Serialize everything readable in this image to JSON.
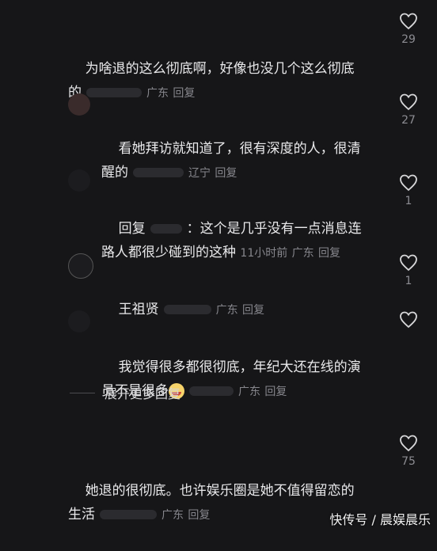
{
  "comments": [
    {
      "text": "为啥退的这么彻底啊，好像也没几个这么彻底",
      "text2": "的",
      "location": "广东",
      "reply": "回复",
      "likes": "29"
    },
    {
      "text": "看她拜访就知道了，很有深度的人，很清",
      "text2": "醒的",
      "location": "辽宁",
      "reply": "回复",
      "likes": "27"
    },
    {
      "text": "回复",
      "text_mid": "：这个是几乎没有一点消息连",
      "text2": "路人都很少碰到的这种",
      "time": "11小时前",
      "location": "广东",
      "reply": "回复",
      "likes": "1"
    },
    {
      "text": "王祖贤",
      "location": "广东",
      "reply": "回复",
      "likes": "1"
    },
    {
      "text": "我觉得很多都很彻底，年纪大还在线的演",
      "text2": "员不是很多",
      "location": "广东",
      "reply": "回复",
      "likes": ""
    },
    {
      "text": "她退的很彻底。也许娱乐圈是她不值得留恋的",
      "text2": "生活",
      "location": "广东",
      "reply": "回复",
      "likes": "75"
    }
  ],
  "expand_label": "展开更多回复",
  "watermark": "快传号 / 晨娱晨乐",
  "colors": {
    "background": "#161618",
    "text": "#e9e9eb",
    "meta": "#86868c"
  },
  "icons": {
    "like": "heart-outline-icon",
    "emoji": "laughing-tears-emoji"
  }
}
